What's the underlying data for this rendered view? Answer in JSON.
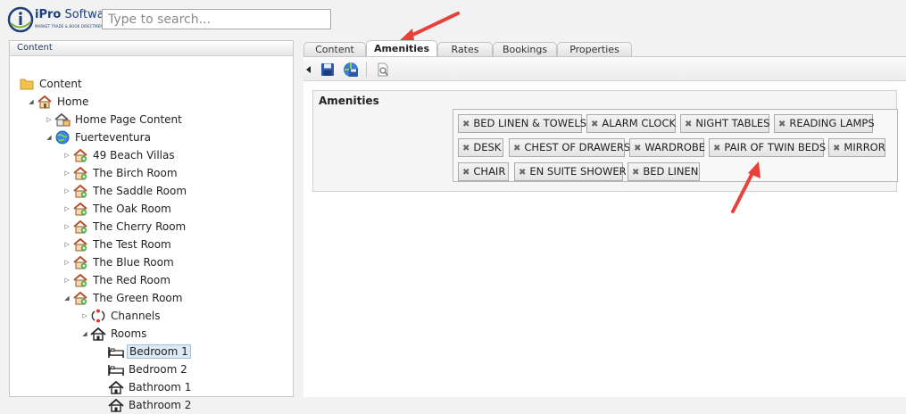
{
  "header": {
    "brand_bold": "iPro",
    "brand_rest": " Software",
    "tagline": "MARKET TRADE & BOOK DIRECTMENTS",
    "search_placeholder": "Type to search..."
  },
  "left_panel": {
    "title": "Content"
  },
  "tree": [
    {
      "label": "Content",
      "icon": "folder-icon",
      "toggle": "",
      "level": 0
    },
    {
      "label": "Home",
      "icon": "home-icon",
      "toggle": "expanded",
      "level": 1
    },
    {
      "label": "Home Page Content",
      "icon": "home-content-icon",
      "toggle": "collapsed",
      "level": 2
    },
    {
      "label": "Fuerteventura",
      "icon": "globe-icon",
      "toggle": "expanded",
      "level": 2
    },
    {
      "label": "49 Beach Villas",
      "icon": "villa-icon",
      "toggle": "collapsed",
      "level": 3
    },
    {
      "label": "The Birch Room",
      "icon": "villa-icon",
      "toggle": "collapsed",
      "level": 3
    },
    {
      "label": "The Saddle Room",
      "icon": "villa-icon",
      "toggle": "collapsed",
      "level": 3
    },
    {
      "label": "The Oak Room",
      "icon": "villa-icon",
      "toggle": "collapsed",
      "level": 3
    },
    {
      "label": "The Cherry Room",
      "icon": "villa-icon",
      "toggle": "collapsed",
      "level": 3
    },
    {
      "label": "The Test Room",
      "icon": "villa-icon",
      "toggle": "collapsed",
      "level": 3
    },
    {
      "label": "The Blue Room",
      "icon": "villa-icon",
      "toggle": "collapsed",
      "level": 3
    },
    {
      "label": "The Red Room",
      "icon": "villa-icon",
      "toggle": "collapsed",
      "level": 3
    },
    {
      "label": "The Green Room",
      "icon": "villa-icon",
      "toggle": "expanded",
      "level": 3
    },
    {
      "label": "Channels",
      "icon": "channels-icon",
      "toggle": "collapsed",
      "level": 4
    },
    {
      "label": "Rooms",
      "icon": "house-outline-icon",
      "toggle": "expanded",
      "level": 4
    },
    {
      "label": "Bedroom 1",
      "icon": "bed-icon",
      "toggle": "",
      "level": 5,
      "selected": true
    },
    {
      "label": "Bedroom 2",
      "icon": "bed-icon",
      "toggle": "",
      "level": 5
    },
    {
      "label": "Bathroom 1",
      "icon": "house-outline-icon",
      "toggle": "",
      "level": 5
    },
    {
      "label": "Bathroom 2",
      "icon": "house-outline-icon",
      "toggle": "",
      "level": 5
    }
  ],
  "tabs": [
    {
      "label": "Content",
      "active": false
    },
    {
      "label": "Amenities",
      "active": true
    },
    {
      "label": "Rates",
      "active": false
    },
    {
      "label": "Bookings",
      "active": false
    },
    {
      "label": "Properties",
      "active": false
    }
  ],
  "amenities": {
    "label": "Amenities",
    "tags": [
      "BED LINEN & TOWELS",
      "ALARM CLOCK",
      "NIGHT TABLES",
      "READING LAMPS",
      "DESK",
      "CHEST OF DRAWERS",
      "WARDROBE",
      "PAIR OF TWIN BEDS",
      "MIRROR",
      "CHAIR",
      "EN SUITE SHOWER",
      "BED LINEN"
    ],
    "remove_glyph": "✖"
  },
  "colors": {
    "accent_arrow": "#e8403a",
    "brand_blue": "#1d3f7a",
    "selection_bg": "#dceaf6"
  }
}
